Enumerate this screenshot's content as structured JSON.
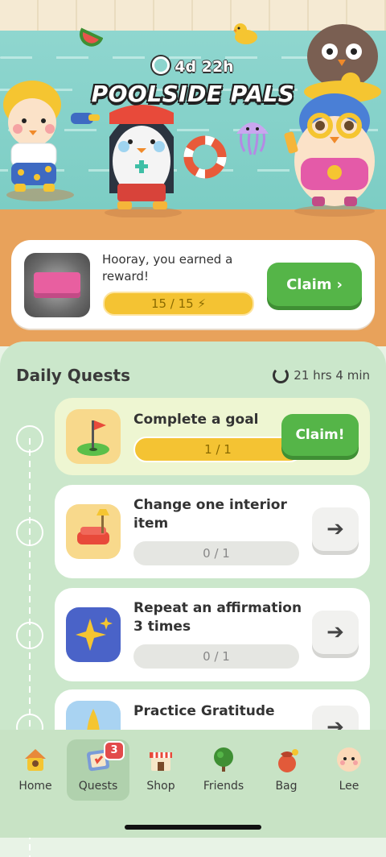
{
  "event": {
    "countdown": "4d 22h",
    "title": "POOLSIDE PALS"
  },
  "reward": {
    "message": "Hooray, you earned a reward!",
    "progress_text": "15 / 15",
    "progress_fraction": 1.0,
    "claim_label": "Claim"
  },
  "daily_quests": {
    "title": "Daily Quests",
    "reset_timer": "21 hrs 4 min",
    "quests": [
      {
        "label": "Complete a goal",
        "progress": "1 / 1",
        "icon": "golf-flag-icon",
        "action_label": "Claim!"
      },
      {
        "label": "Change one interior item",
        "progress": "0 / 1",
        "icon": "sofa-lamp-icon"
      },
      {
        "label": "Repeat an affirmation 3 times",
        "progress": "0 / 1",
        "icon": "sparkle-icon"
      },
      {
        "label": "Practice Gratitude",
        "progress": "",
        "icon": "praying-hands-icon"
      }
    ]
  },
  "nav": {
    "items": [
      {
        "label": "Home",
        "icon": "house-icon"
      },
      {
        "label": "Quests",
        "icon": "quests-icon",
        "badge": "3"
      },
      {
        "label": "Shop",
        "icon": "shop-icon"
      },
      {
        "label": "Friends",
        "icon": "tree-icon"
      },
      {
        "label": "Bag",
        "icon": "bag-icon"
      },
      {
        "label": "Lee",
        "icon": "avatar-icon"
      }
    ]
  },
  "colors": {
    "accent_green": "#55b548",
    "progress_yellow": "#f4c333",
    "panel_bg": "#cbe7cb"
  }
}
